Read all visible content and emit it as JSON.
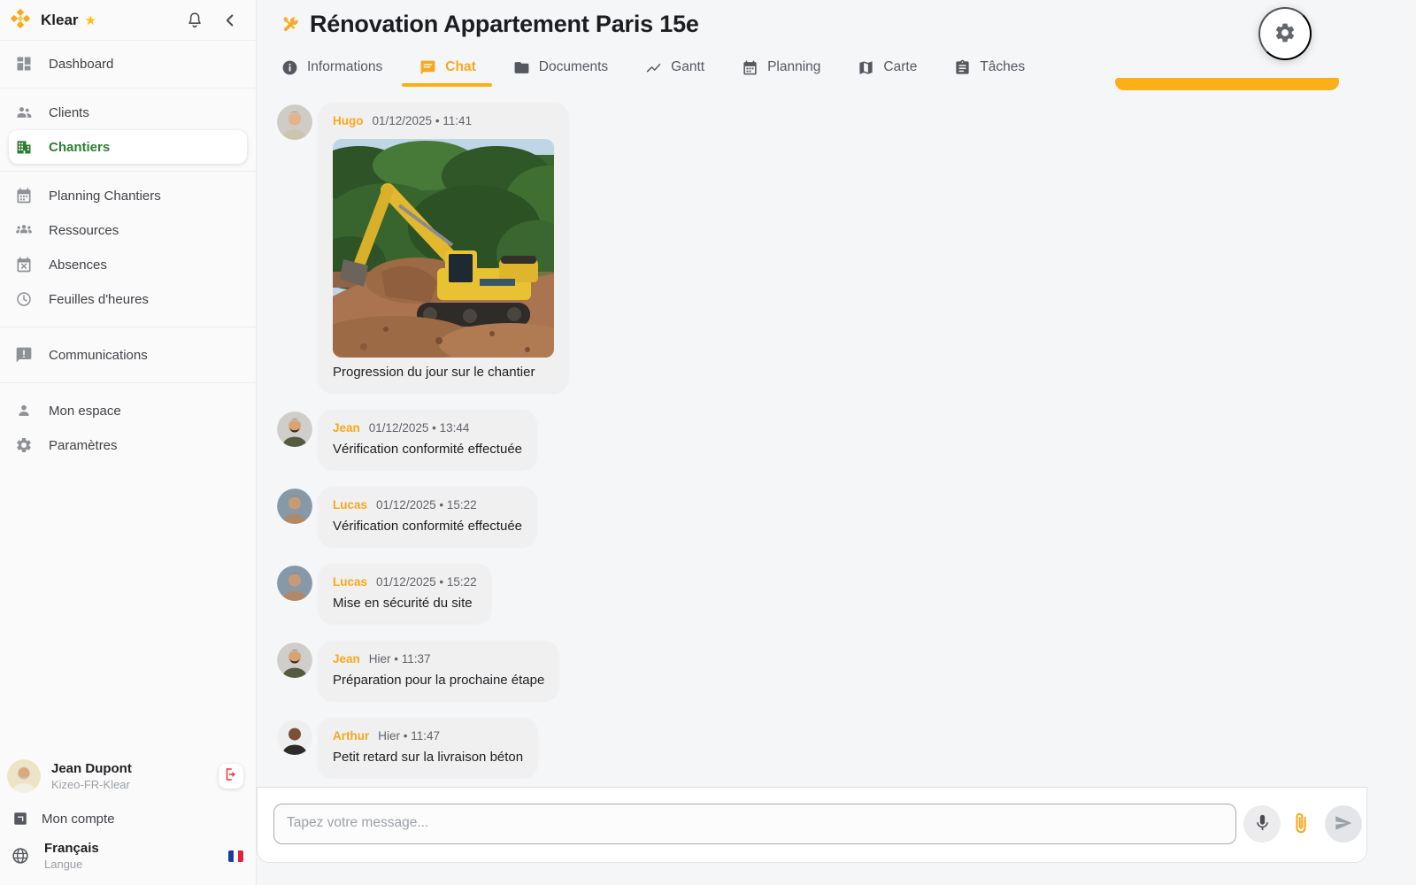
{
  "brand": {
    "name": "Klear",
    "star": "★"
  },
  "sidebar": {
    "items": [
      {
        "label": "Dashboard",
        "icon": "dashboard-icon",
        "active": false,
        "divider_after": true,
        "wide": false
      },
      {
        "label": "Clients",
        "icon": "clients-icon",
        "active": false,
        "divider_after": false,
        "wide": false
      },
      {
        "label": "Chantiers",
        "icon": "building-icon",
        "active": true,
        "divider_after": true,
        "wide": false
      },
      {
        "label": "Planning Chantiers",
        "icon": "calendar-icon",
        "active": false,
        "divider_after": false,
        "wide": false
      },
      {
        "label": "Ressources",
        "icon": "groups-icon",
        "active": false,
        "divider_after": false,
        "wide": false
      },
      {
        "label": "Absences",
        "icon": "calendar-x-icon",
        "active": false,
        "divider_after": false,
        "wide": false
      },
      {
        "label": "Feuilles d'heures",
        "icon": "clock-icon",
        "active": false,
        "divider_after": true,
        "wide": true
      },
      {
        "label": "Communications",
        "icon": "announcement-icon",
        "active": false,
        "divider_after": true,
        "wide": true
      },
      {
        "label": "Mon espace",
        "icon": "person-icon",
        "active": false,
        "divider_after": false,
        "wide": false
      },
      {
        "label": "Paramètres",
        "icon": "gear-icon",
        "active": false,
        "divider_after": false,
        "wide": false
      }
    ],
    "user": {
      "name": "Jean Dupont",
      "org": "Kizeo-FR-Klear"
    },
    "account_label": "Mon compte",
    "language": {
      "value": "Français",
      "caption": "Langue"
    }
  },
  "header": {
    "title": "Rénovation Appartement Paris 15e"
  },
  "tabs": [
    {
      "label": "Informations",
      "icon": "info-icon",
      "active": false
    },
    {
      "label": "Chat",
      "icon": "chat-icon",
      "active": true
    },
    {
      "label": "Documents",
      "icon": "folder-icon",
      "active": false
    },
    {
      "label": "Gantt",
      "icon": "gantt-icon",
      "active": false
    },
    {
      "label": "Planning",
      "icon": "calendar-icon",
      "active": false
    },
    {
      "label": "Carte",
      "icon": "map-icon",
      "active": false
    },
    {
      "label": "Tâches",
      "icon": "tasks-icon",
      "active": false
    }
  ],
  "chat": {
    "messages": [
      {
        "author": "Hugo",
        "timestamp": "01/12/2025 • 11:41",
        "text": "Progression du jour sur le chantier",
        "image": "excavator-photo",
        "avatar": "hugo"
      },
      {
        "author": "Jean",
        "timestamp": "01/12/2025 • 13:44",
        "text": "Vérification conformité effectuée",
        "image": null,
        "avatar": "jean"
      },
      {
        "author": "Lucas",
        "timestamp": "01/12/2025 • 15:22",
        "text": "Vérification conformité effectuée",
        "image": null,
        "avatar": "lucas"
      },
      {
        "author": "Lucas",
        "timestamp": "01/12/2025 • 15:22",
        "text": "Mise en sécurité du site",
        "image": null,
        "avatar": "lucas"
      },
      {
        "author": "Jean",
        "timestamp": "Hier • 11:37",
        "text": "Préparation pour la prochaine étape",
        "image": null,
        "avatar": "jean"
      },
      {
        "author": "Arthur",
        "timestamp": "Hier • 11:47",
        "text": "Petit retard sur la livraison béton",
        "image": null,
        "avatar": "arthur"
      }
    ],
    "input_placeholder": "Tapez votre message..."
  },
  "colors": {
    "accent": "#F9A81B",
    "active_green": "#2E7D32",
    "logout_red": "#E53935",
    "amber_bar": "#FCAF17"
  }
}
